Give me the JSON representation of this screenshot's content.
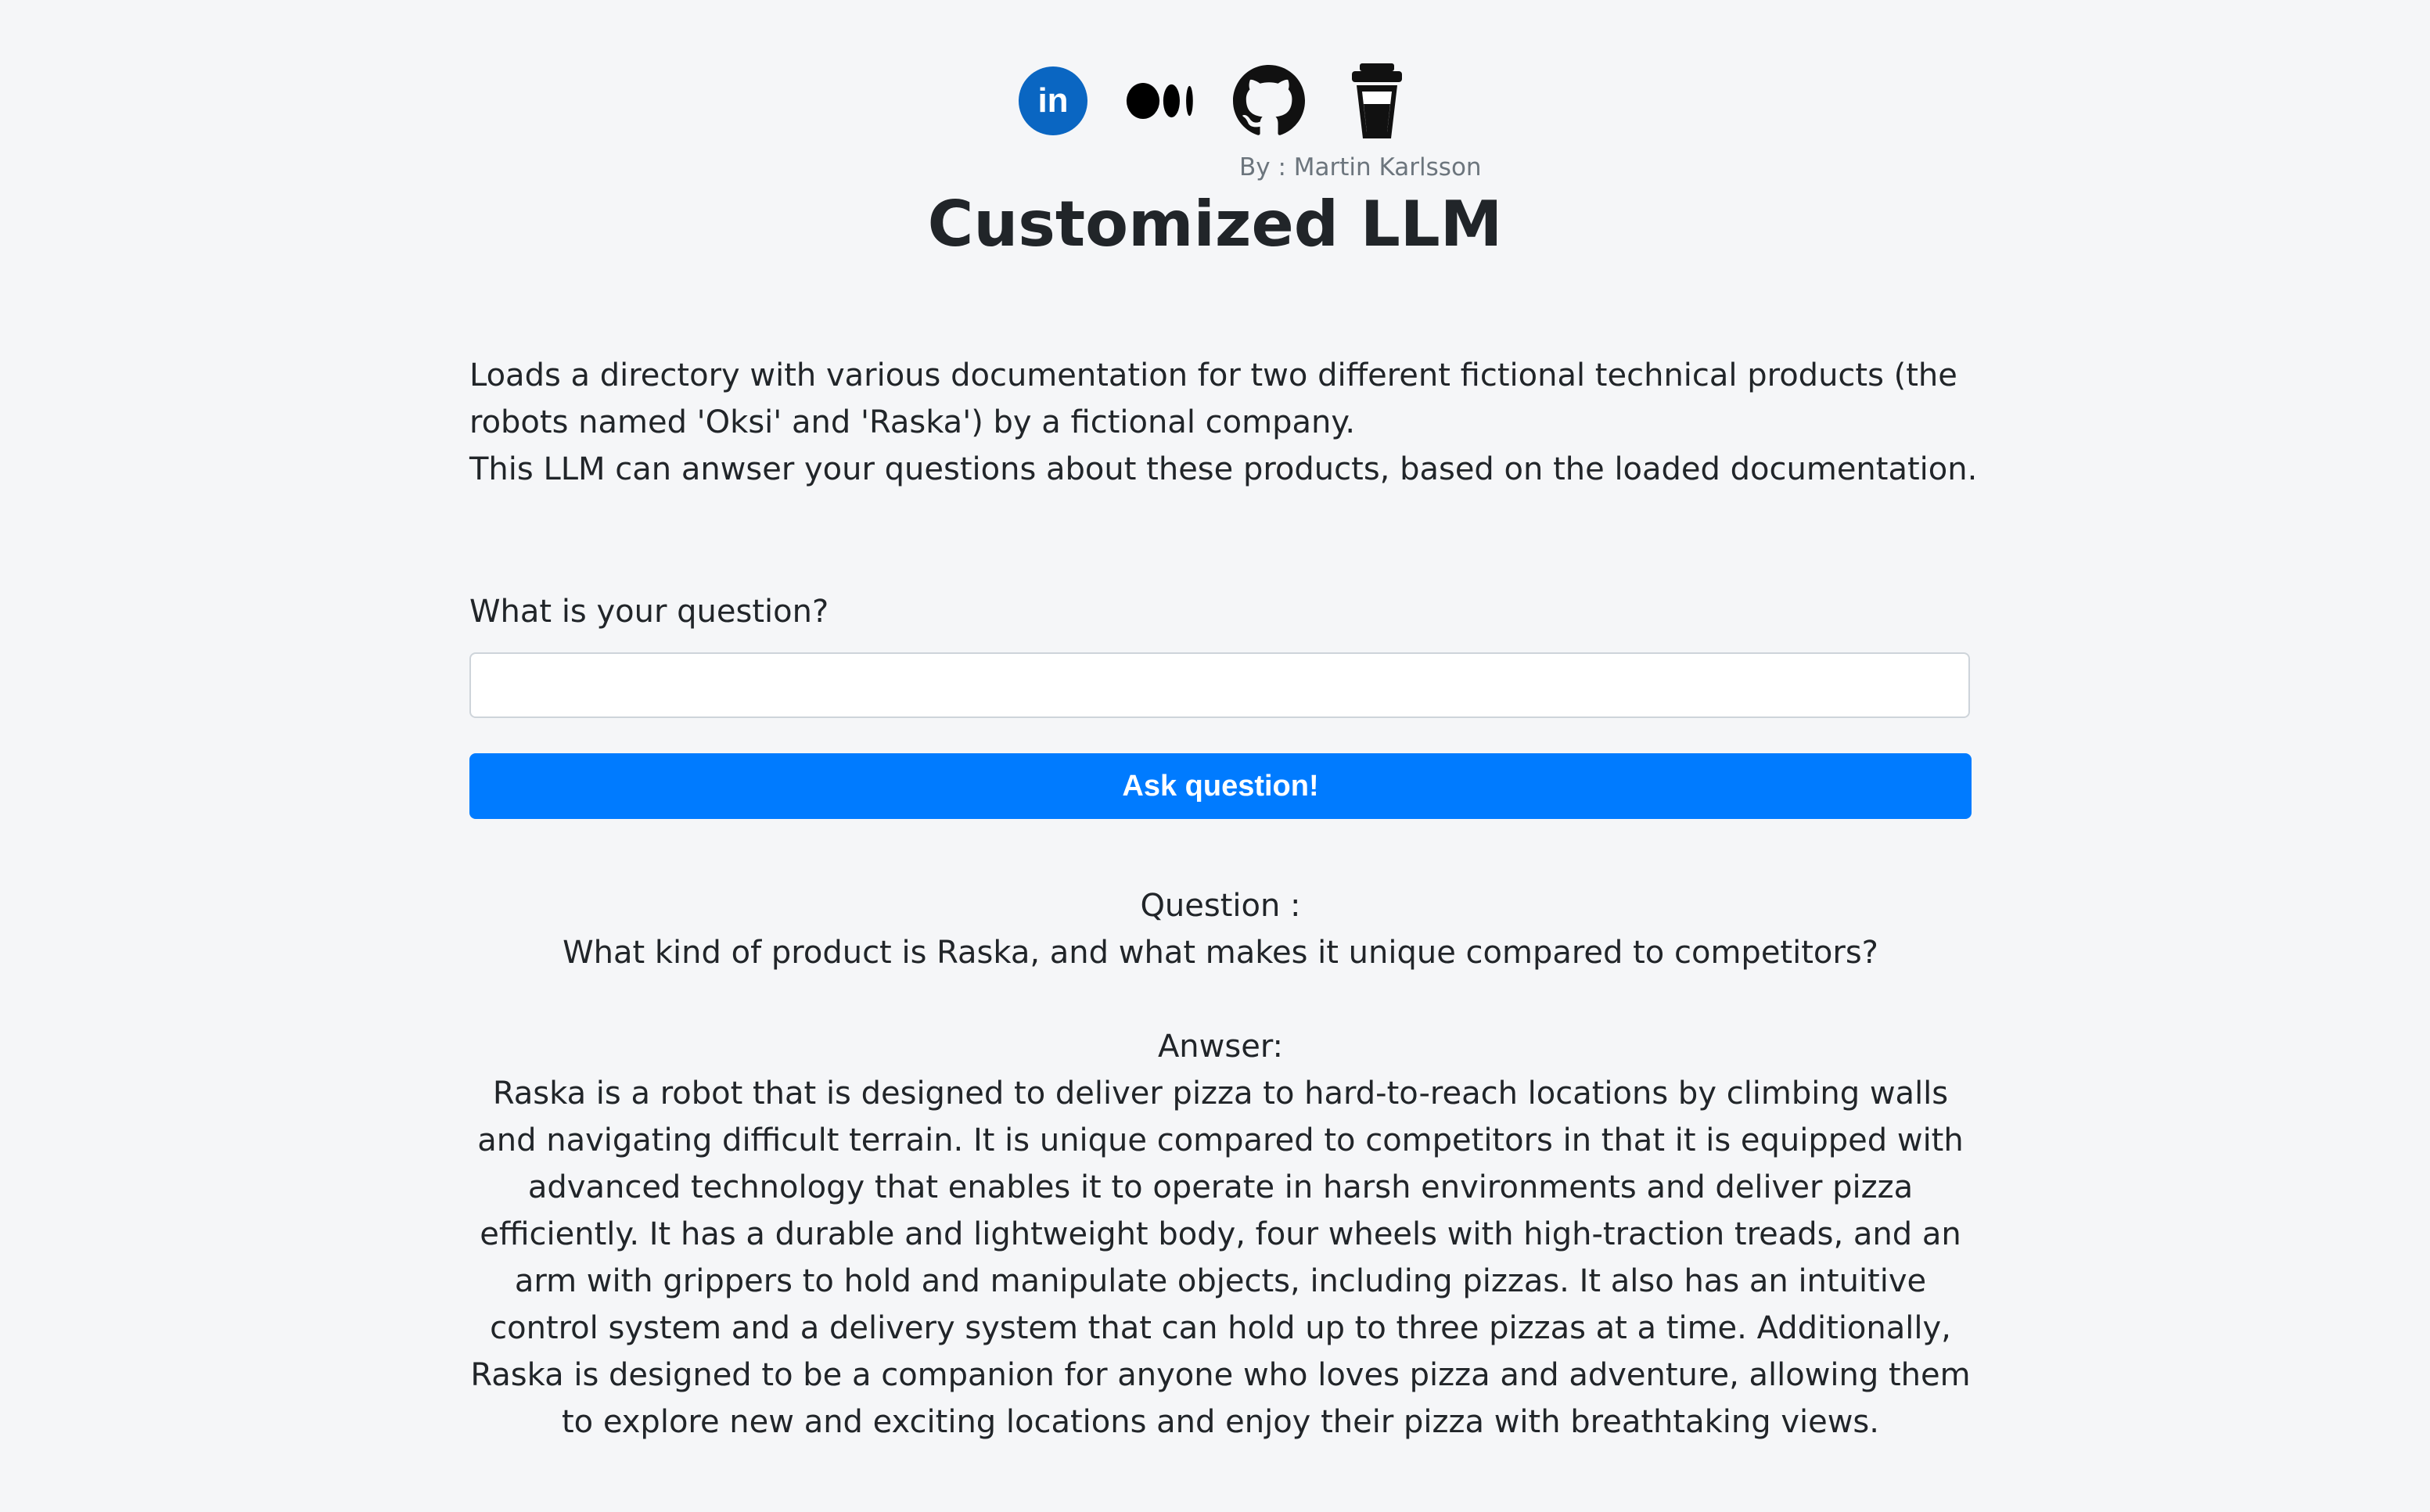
{
  "social": {
    "icons": [
      {
        "name": "linkedin-icon",
        "label": "in",
        "color": "#0a66c2"
      },
      {
        "name": "medium-icon",
        "color": "#000000"
      },
      {
        "name": "github-icon",
        "color": "#111111"
      },
      {
        "name": "buy-me-a-coffee-icon",
        "color": "#111111"
      }
    ]
  },
  "header": {
    "byline": "By : Martin Karlsson",
    "title": "Customized LLM"
  },
  "intro": {
    "line1": "Loads a directory with various documentation for two different fictional technical products (the robots named 'Oksi' and 'Raska') by a fictional company.",
    "line2": "This LLM can anwser your questions about these products, based on the loaded documentation."
  },
  "form": {
    "question_label": "What is your question?",
    "question_value": "",
    "question_placeholder": "",
    "submit_label": "Ask question!"
  },
  "result": {
    "question_heading": "Question :",
    "question_text": "What kind of product is Raska, and what makes it unique compared to competitors?",
    "answer_heading": "Anwser:",
    "answer_text": "Raska is a robot that is designed to deliver pizza to hard-to-reach locations by climbing walls and navigating difficult terrain. It is unique compared to competitors in that it is equipped with advanced technology that enables it to operate in harsh environments and deliver pizza efficiently. It has a durable and lightweight body, four wheels with high-traction treads, and an arm with grippers to hold and manipulate objects, including pizzas. It also has an intuitive control system and a delivery system that can hold up to three pizzas at a time. Additionally, Raska is designed to be a companion for anyone who loves pizza and adventure, allowing them to explore new and exciting locations and enjoy their pizza with breathtaking views."
  },
  "colors": {
    "background": "#f5f6f8",
    "accent": "#007bff",
    "text": "#212529",
    "muted": "#6c757d"
  }
}
